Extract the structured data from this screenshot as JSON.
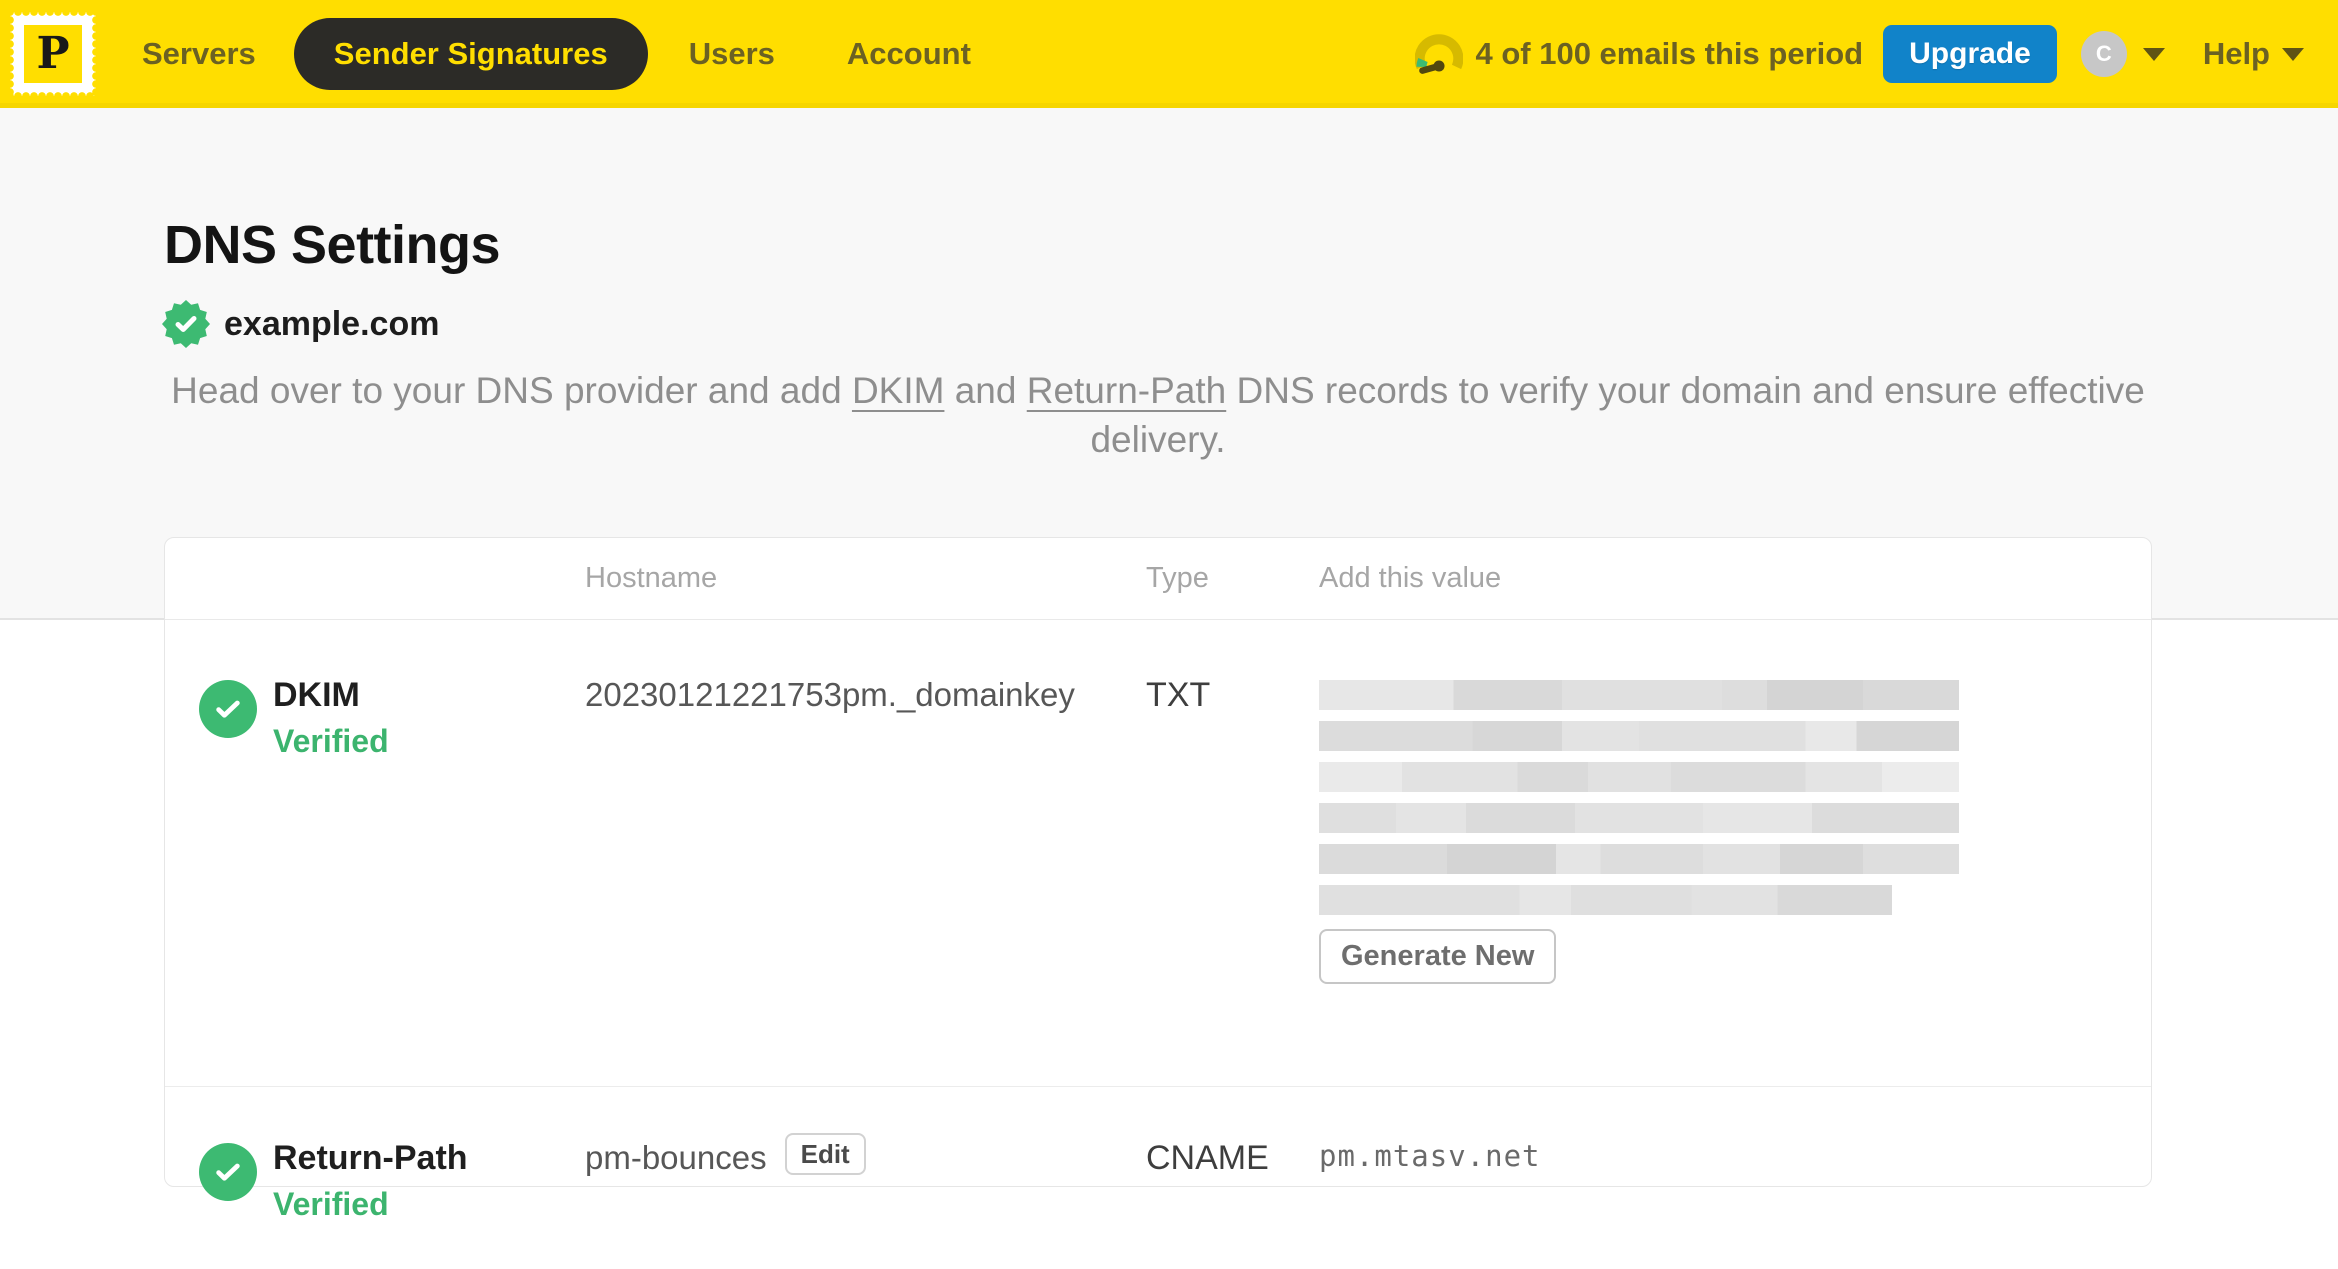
{
  "topbar": {
    "logo_letter": "P",
    "nav": [
      {
        "label": "Servers",
        "active": false
      },
      {
        "label": "Sender Signatures",
        "active": true
      },
      {
        "label": "Users",
        "active": false
      },
      {
        "label": "Account",
        "active": false
      }
    ],
    "usage_text": "4 of 100 emails this period",
    "upgrade_label": "Upgrade",
    "avatar_letter": "C",
    "help_label": "Help"
  },
  "page": {
    "title": "DNS Settings",
    "domain": "example.com",
    "description": {
      "part1": "Head over to your DNS provider and add ",
      "link_dkim": "DKIM",
      "part2": " and ",
      "link_return_path": "Return-Path",
      "part3": " DNS records to verify your domain and ensure effective delivery."
    }
  },
  "table": {
    "headers": {
      "hostname": "Hostname",
      "type": "Type",
      "value": "Add this value"
    },
    "rows": [
      {
        "name": "DKIM",
        "status": "Verified",
        "hostname": "20230121221753pm._domainkey",
        "type": "TXT",
        "value_redacted": true,
        "action_label": "Generate New"
      },
      {
        "name": "Return-Path",
        "status": "Verified",
        "hostname": "pm-bounces",
        "edit_label": "Edit",
        "type": "CNAME",
        "value": "pm.mtasv.net"
      }
    ]
  },
  "colors": {
    "brand_yellow": "#FFDE00",
    "upgrade_blue": "#1183C9",
    "verified_green": "#3DBA72",
    "active_pill_dark": "#2C2B27"
  }
}
